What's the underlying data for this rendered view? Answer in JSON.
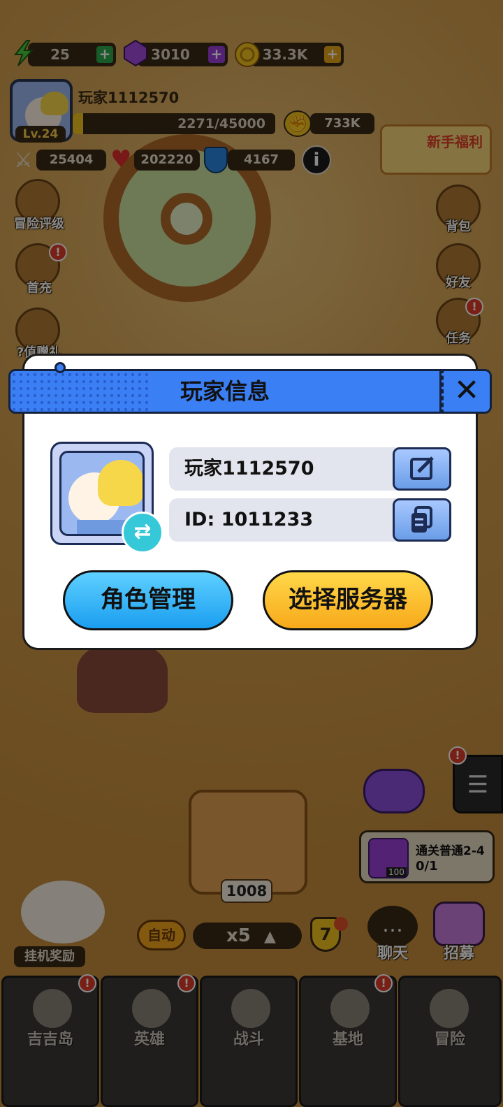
{
  "resources": {
    "energy": {
      "value": "25",
      "color": "#3ec43a"
    },
    "gems": {
      "value": "3010",
      "color": "#9b3fd8"
    },
    "coins": {
      "value": "33.3K",
      "color": "#f2b81e"
    }
  },
  "profile": {
    "name": "玩家1112570",
    "level": "Lv.24",
    "exp": "2271/45000",
    "exp_progress": 0.05,
    "power": "733K"
  },
  "stats": {
    "attack": "25404",
    "hp": "202220",
    "defense": "4167"
  },
  "left_menu": [
    {
      "label": "冒险评级",
      "icon": "trophy-icon"
    },
    {
      "label": "首充",
      "icon": "hero-icon"
    },
    {
      "label": "?值赠礼",
      "icon": "money-bag-icon"
    }
  ],
  "right_menu": [
    {
      "label": "背包",
      "icon": "backpack-icon"
    },
    {
      "label": "好友",
      "icon": "friends-icon"
    },
    {
      "label": "任务",
      "icon": "scroll-icon"
    }
  ],
  "newbie_welfare": "新手福利",
  "quest": {
    "title": "通关普通2-4",
    "progress": "0/1",
    "reward_count": "100"
  },
  "chest_count": "1008",
  "battle_controls": {
    "auto_label": "自动",
    "speed": "x5",
    "level_badge": "7"
  },
  "chat_label": "聊天",
  "recruit_label": "招募",
  "idle_reward_label": "挂机奖励",
  "bottom_nav": [
    {
      "label": "吉吉岛",
      "icon": "palm-island-icon"
    },
    {
      "label": "英雄",
      "icon": "pig-hero-icon"
    },
    {
      "label": "战斗",
      "icon": "crossed-swords-icon"
    },
    {
      "label": "基地",
      "icon": "base-icon"
    },
    {
      "label": "冒险",
      "icon": "skull-flame-icon"
    }
  ],
  "dialog": {
    "title": "玩家信息",
    "player_name": "玩家1112570",
    "player_id": "ID: 1011233",
    "role_management_label": "角色管理",
    "select_server_label": "选择服务器",
    "accent_blue": "#3b7ff5",
    "accent_yellow": "#ffc21a"
  }
}
